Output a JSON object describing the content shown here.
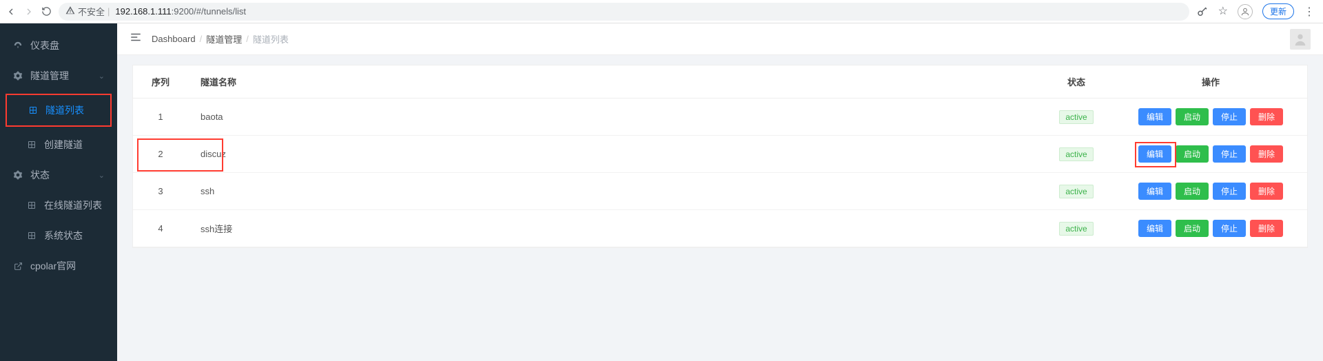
{
  "browser": {
    "insecure_label": "不安全",
    "url_host": "192.168.1.111",
    "url_port": ":9200",
    "url_path": "/#/tunnels/list",
    "update_label": "更新"
  },
  "sidebar": {
    "items": [
      {
        "icon": "dashboard",
        "label": "仪表盘",
        "expandable": false
      },
      {
        "icon": "settings",
        "label": "隧道管理",
        "expandable": true,
        "expanded": true,
        "children": [
          {
            "icon": "grid",
            "label": "隧道列表",
            "active": true
          },
          {
            "icon": "grid",
            "label": "创建隧道"
          }
        ]
      },
      {
        "icon": "settings",
        "label": "状态",
        "expandable": true,
        "expanded": true,
        "children": [
          {
            "icon": "grid",
            "label": "在线隧道列表"
          },
          {
            "icon": "grid",
            "label": "系统状态"
          }
        ]
      },
      {
        "icon": "external",
        "label": "cpolar官网",
        "expandable": false
      }
    ]
  },
  "breadcrumb": {
    "root": "Dashboard",
    "mid": "隧道管理",
    "leaf": "隧道列表"
  },
  "table": {
    "headers": {
      "idx": "序列",
      "name": "隧道名称",
      "status": "状态",
      "ops": "操作"
    },
    "buttons": {
      "edit": "编辑",
      "start": "启动",
      "stop": "停止",
      "delete": "删除"
    },
    "rows": [
      {
        "idx": "1",
        "name": "baota",
        "status": "active"
      },
      {
        "idx": "2",
        "name": "discuz",
        "status": "active"
      },
      {
        "idx": "3",
        "name": "ssh",
        "status": "active"
      },
      {
        "idx": "4",
        "name": "ssh连接",
        "status": "active"
      }
    ]
  }
}
